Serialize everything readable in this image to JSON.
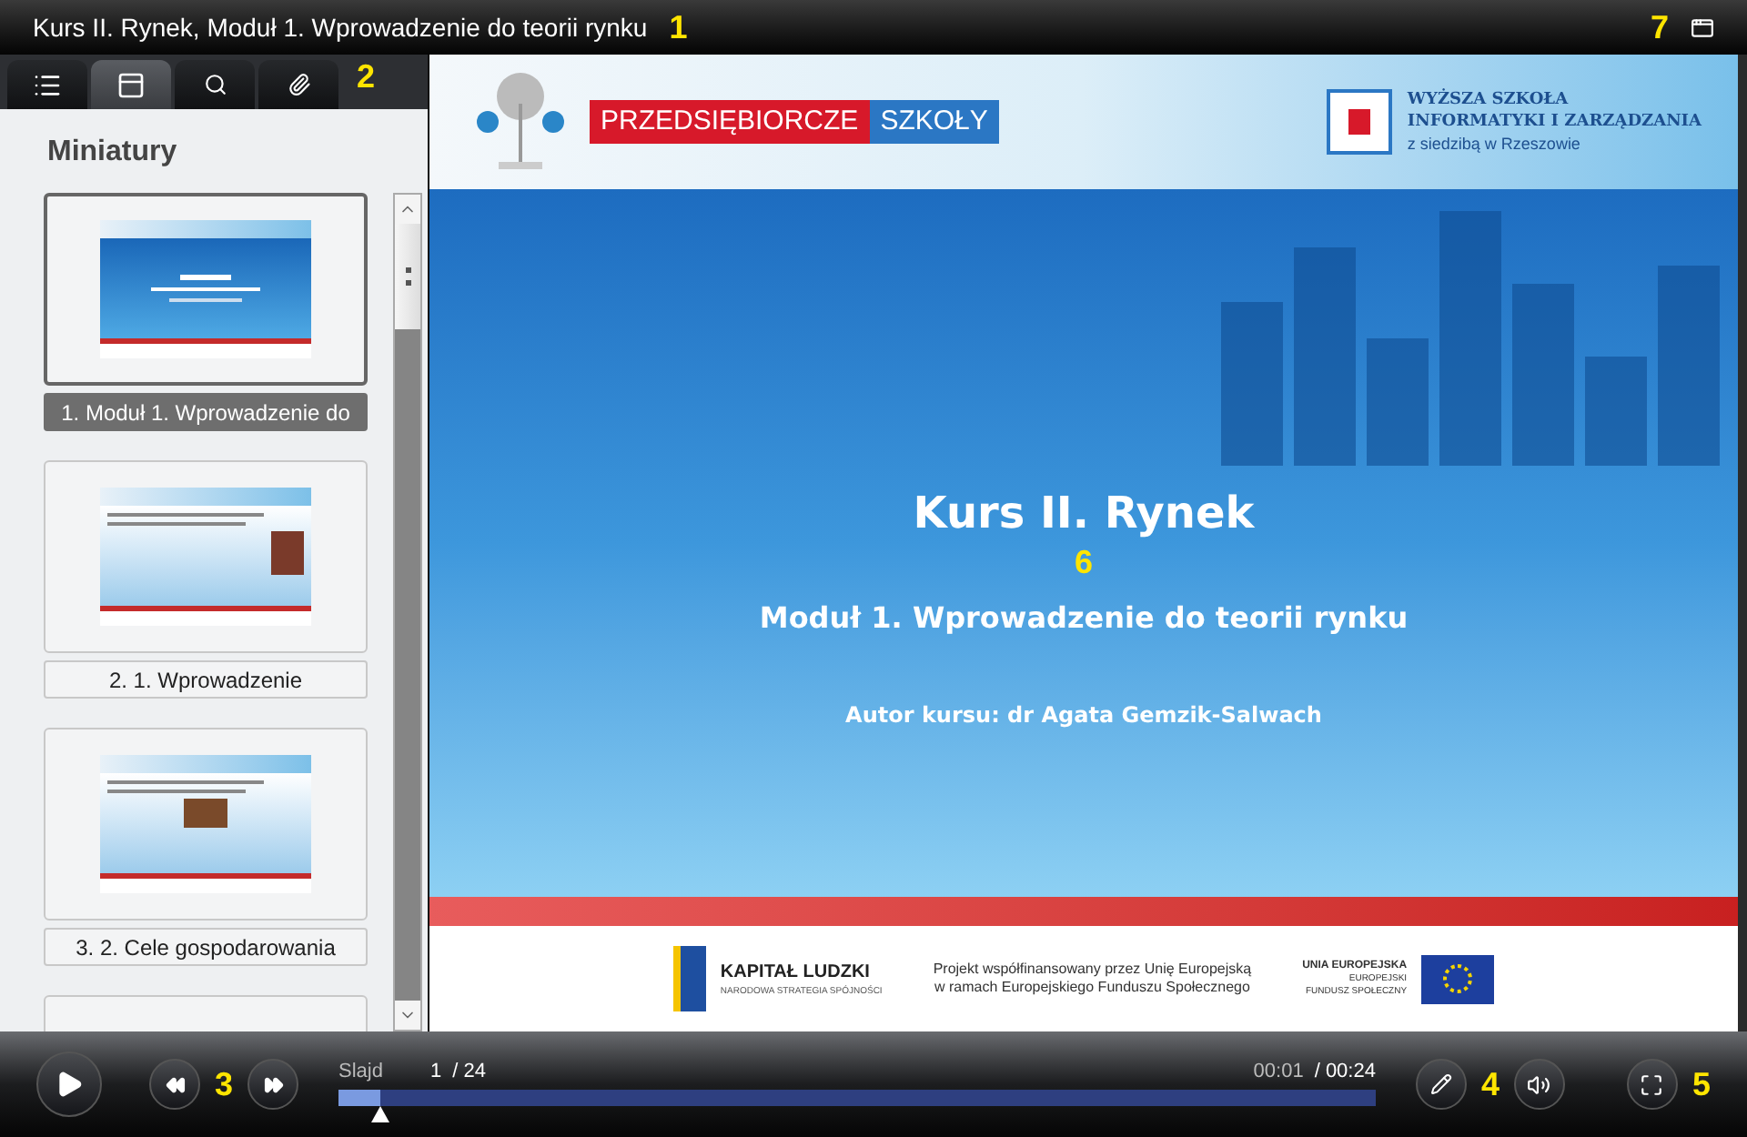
{
  "window": {
    "title": "Kurs II. Rynek, Moduł 1. Wprowadzenie do teorii rynku"
  },
  "tabs": [
    {
      "kind": "outline",
      "selected": false
    },
    {
      "kind": "thumbnails",
      "selected": true
    },
    {
      "kind": "search",
      "selected": false
    },
    {
      "kind": "attachments",
      "selected": false
    }
  ],
  "sidebar": {
    "title": "Miniatury",
    "items": [
      {
        "label": "1. Moduł 1. Wprowadzenie do",
        "kind": "title",
        "selected": true
      },
      {
        "label": "2. 1. Wprowadzenie",
        "kind": "text",
        "selected": false
      },
      {
        "label": "3. 2. Cele gospodarowania",
        "kind": "photo",
        "selected": false
      },
      {
        "kind": "partial",
        "selected": false
      }
    ]
  },
  "slide": {
    "brand_left": "PRZEDSIĘBIORCZE",
    "brand_right": "SZKOŁY",
    "school": [
      "WYŻSZA SZKOŁA",
      "INFORMATYKI I ZARZĄDZANIA",
      "z siedzibą w Rzeszowie"
    ],
    "title": "Kurs II. Rynek",
    "subtitle": "Moduł 1. Wprowadzenie do teorii rynku",
    "author": "Autor kursu: dr Agata Gemzik-Salwach",
    "footer": {
      "kl_title": "KAPITAŁ LUDZKI",
      "kl_sub": "NARODOWA STRATEGIA SPÓJNOŚCI",
      "project": [
        "Projekt współfinansowany przez Unię Europejską",
        "w ramach Europejskiego Funduszu Społecznego"
      ],
      "eu": [
        "UNIA EUROPEJSKA",
        "EUROPEJSKI",
        "FUNDUSZ SPOŁECZNY"
      ]
    }
  },
  "player": {
    "slide_label": "Slajd",
    "slide_current": "1",
    "slide_total": "/ 24",
    "time_elapsed": "00:01",
    "time_total": "/ 00:24",
    "level": 0.04
  },
  "callouts": [
    "1",
    "2",
    "3",
    "4",
    "5",
    "6",
    "7"
  ]
}
